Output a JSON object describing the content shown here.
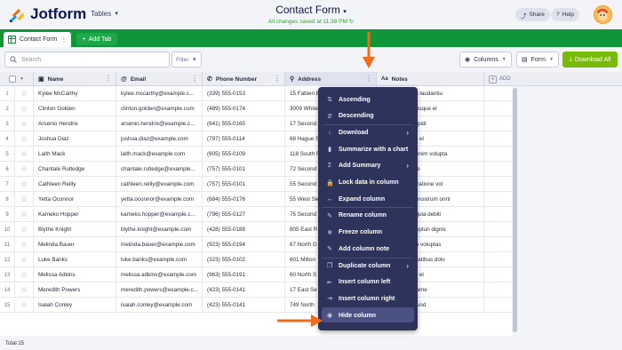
{
  "app": {
    "logo_text": "Jotform",
    "tables_menu": "Tables",
    "form_title": "Contact Form",
    "saved_status": "All changes saved at 11:38 PM",
    "share_label": "Share",
    "help_label": "Help"
  },
  "tabs": {
    "active_label": "Contact Form",
    "add_tab_label": "Add Tab"
  },
  "toolbar": {
    "search_placeholder": "Search",
    "filter_label": "Filter",
    "columns_label": "Columns",
    "form_label": "Form",
    "download_label": "Download All"
  },
  "grid": {
    "columns": [
      "Name",
      "Email",
      "Phone Number",
      "Address",
      "Notes"
    ],
    "add_column_label": "ADD",
    "rows": [
      [
        "1",
        "Kylee McCarthy",
        "kylee.mccarthy@example.c...",
        "(339) 555-0153",
        "15 Fabien B",
        "dolore odit non laudantiu"
      ],
      [
        "2",
        "Clinton Golden",
        "clinton.golden@example.com",
        "(489) 555-0174",
        "3009 White",
        "lla unde nulla esque el"
      ],
      [
        "3",
        "Arsenio Hendrix",
        "arsenio.hendrix@example.c...",
        "(641) 555-0165",
        "17 Second",
        "d non quasi cupidi"
      ],
      [
        "4",
        "Joshua Diaz",
        "joshua.diaz@example.com",
        "(797) 555-0114",
        "68 Hague S",
        "equi est labore el"
      ],
      [
        "5",
        "Laith Mack",
        "laith.mack@example.com",
        "(605) 555-0109",
        "118 South F",
        "pariatur dolor enim volupta"
      ],
      [
        "6",
        "Chantale Rutledge",
        "chantale.rutledge@example...",
        "(757) 555-0101",
        "72 Second",
        "s ex velit dolore"
      ],
      [
        "7",
        "Cathleen Reilly",
        "cathleen.reilly@example.com",
        "(757) 555-0101",
        "55 Second",
        "e officiis inure ratione vol"
      ],
      [
        "8",
        "Yetta Oconnor",
        "yetta.oconnor@example.com",
        "(684) 555-0176",
        "55 West Se",
        "mollit laborum nostrum onnl"
      ],
      [
        "9",
        "Kameko Hopper",
        "kameko.hopper@example.c...",
        "(796) 555-0127",
        "75 Second",
        "ut velit ipsum quia debiti"
      ],
      [
        "10",
        "Blythe Knight",
        "blythe.knight@example.com",
        "(428) 555-0188",
        "805 East R",
        "enim sunt excepturi dignis"
      ],
      [
        "11",
        "Melinda Bauer",
        "melinda.bauer@example.com",
        "(923) 555-0194",
        "67 North G",
        "lore mollit enim voluptas"
      ],
      [
        "12",
        "Luke Banks",
        "luke.banks@example.com",
        "(323) 555-0102",
        "601 Milton",
        "nostrum voluptatibus dolo"
      ],
      [
        "13",
        "Melissa Adkins",
        "melissa.adkins@example.com",
        "(963) 555-0191",
        "60 North S",
        "ipsa quia ut eu et"
      ],
      [
        "14",
        "Meredith Powers",
        "meredith.powers@example.c...",
        "(423) 555-0141",
        "17 East Se",
        "quod quisque ame"
      ],
      [
        "15",
        "Isaiah Conley",
        "isaiah.conley@example.com",
        "(423) 555-0141",
        "749 North",
        "unde quia ut quod"
      ]
    ]
  },
  "footer": {
    "total_label": "Total 15"
  },
  "menu": {
    "items": [
      {
        "label": "Ascending",
        "icon": "sort-ascending-icon",
        "glyph": "⇅",
        "chevron": false
      },
      {
        "label": "Descending",
        "icon": "sort-descending-icon",
        "glyph": "⇵",
        "chevron": false
      },
      {
        "label": "Download",
        "icon": "download-icon",
        "glyph": "↓",
        "chevron": true
      },
      {
        "label": "Summarize with a chart",
        "icon": "chart-icon",
        "glyph": "▮",
        "chevron": false
      },
      {
        "label": "Add Summary",
        "icon": "summary-icon",
        "glyph": "Σ",
        "chevron": true
      },
      {
        "label": "Lock data in column",
        "icon": "lock-icon",
        "glyph": "🔒",
        "chevron": false
      },
      {
        "label": "Expand column",
        "icon": "expand-icon",
        "glyph": "↔",
        "chevron": false
      },
      {
        "label": "Rename column",
        "icon": "pencil-icon",
        "glyph": "✎",
        "chevron": false
      },
      {
        "label": "Freeze column",
        "icon": "freeze-icon",
        "glyph": "❄",
        "chevron": false
      },
      {
        "label": "Add column note",
        "icon": "note-icon",
        "glyph": "✎",
        "chevron": false
      },
      {
        "label": "Duplicate column",
        "icon": "duplicate-icon",
        "glyph": "❐",
        "chevron": true
      },
      {
        "label": "Insert column left",
        "icon": "insert-left-icon",
        "glyph": "⇤",
        "chevron": false
      },
      {
        "label": "Insert column right",
        "icon": "insert-right-icon",
        "glyph": "⇥",
        "chevron": false
      },
      {
        "label": "Hide column",
        "icon": "hide-eye-icon",
        "glyph": "◉",
        "chevron": false
      }
    ]
  },
  "colors": {
    "brand_green": "#0f9638",
    "download_green": "#78bb07",
    "menu_bg": "#2d335b",
    "arrow_orange": "#f26b1d"
  }
}
